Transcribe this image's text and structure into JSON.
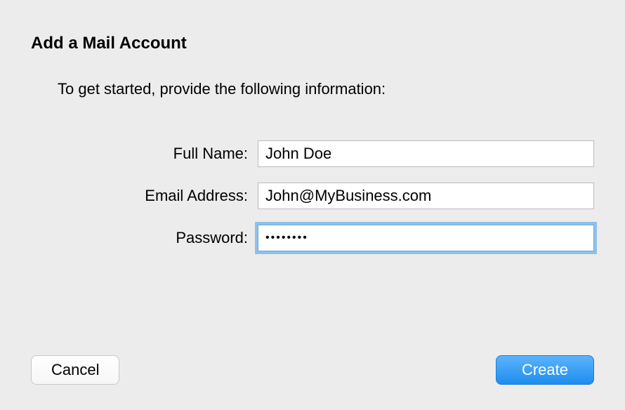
{
  "title": "Add a Mail Account",
  "subtitle": "To get started, provide the following information:",
  "fields": {
    "full_name": {
      "label": "Full Name:",
      "value": "John Doe"
    },
    "email": {
      "label": "Email Address:",
      "value": "John@MyBusiness.com"
    },
    "password": {
      "label": "Password:",
      "value": "••••••••"
    }
  },
  "buttons": {
    "cancel": "Cancel",
    "create": "Create"
  }
}
